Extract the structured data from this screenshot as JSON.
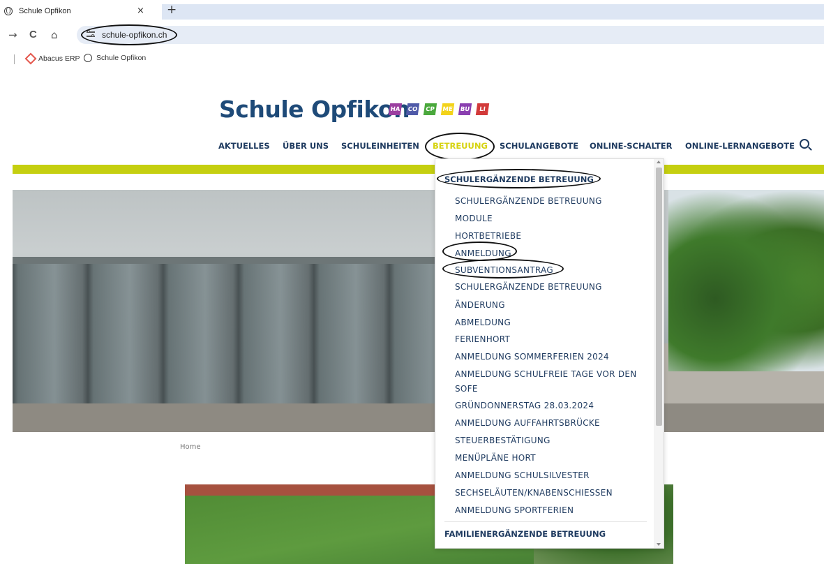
{
  "browser": {
    "tab_title": "Schule Opfikon",
    "tab_close": "×",
    "new_tab": "+",
    "back": "→",
    "reload": "C",
    "home": "⌂",
    "url": "schule-opfikon.ch",
    "bookmarks": [
      {
        "label": "Abacus ERP",
        "icon": "abacus-icon"
      },
      {
        "label": "Schule Opfikon",
        "icon": "globe-icon"
      }
    ]
  },
  "site": {
    "title": "Schule Opfikon",
    "logos": [
      {
        "text": "HA",
        "color": "#9b3fa0"
      },
      {
        "text": "CO",
        "color": "#4f5aa8"
      },
      {
        "text": "CP",
        "color": "#4aa83c"
      },
      {
        "text": "ME",
        "color": "#f3d31a"
      },
      {
        "text": "BU",
        "color": "#8a3fb0"
      },
      {
        "text": "LI",
        "color": "#d23a3a"
      }
    ],
    "accent_color": "#c5cf10",
    "nav": [
      {
        "label": "AKTUELLES"
      },
      {
        "label": "ÜBER UNS"
      },
      {
        "label": "SCHULEINHEITEN"
      },
      {
        "label": "BETREUUNG"
      },
      {
        "label": "SCHULANGEBOTE"
      },
      {
        "label": "ONLINE-SCHALTER"
      },
      {
        "label": "ONLINE-LERNANGEBOTE"
      }
    ],
    "breadcrumb": "Home"
  },
  "dropdown": {
    "section1": "SCHULERGÄNZENDE BETREUUNG",
    "items": [
      "SCHULERGÄNZENDE BETREUUNG",
      "MODULE",
      "HORTBETRIEBE",
      "ANMELDUNG",
      "SUBVENTIONSANTRAG",
      "SCHULERGÄNZENDE BETREUUNG",
      "ÄNDERUNG",
      "ABMELDUNG",
      "FERIENHORT",
      "ANMELDUNG SOMMERFERIEN 2024",
      "ANMELDUNG SCHULFREIE TAGE VOR DEN",
      "SOFE",
      "GRÜNDONNERSTAG 28.03.2024",
      "ANMELDUNG AUFFAHRTSBRÜCKE",
      "STEUERBESTÄTIGUNG",
      "MENÜPLÄNE HORT",
      "ANMELDUNG SCHULSILVESTER",
      "SECHSELÄUTEN/KNABENSCHIESSEN",
      "ANMELDUNG SPORTFERIEN"
    ],
    "section2": "FAMILIENERGÄNZENDE BETREUUNG"
  }
}
